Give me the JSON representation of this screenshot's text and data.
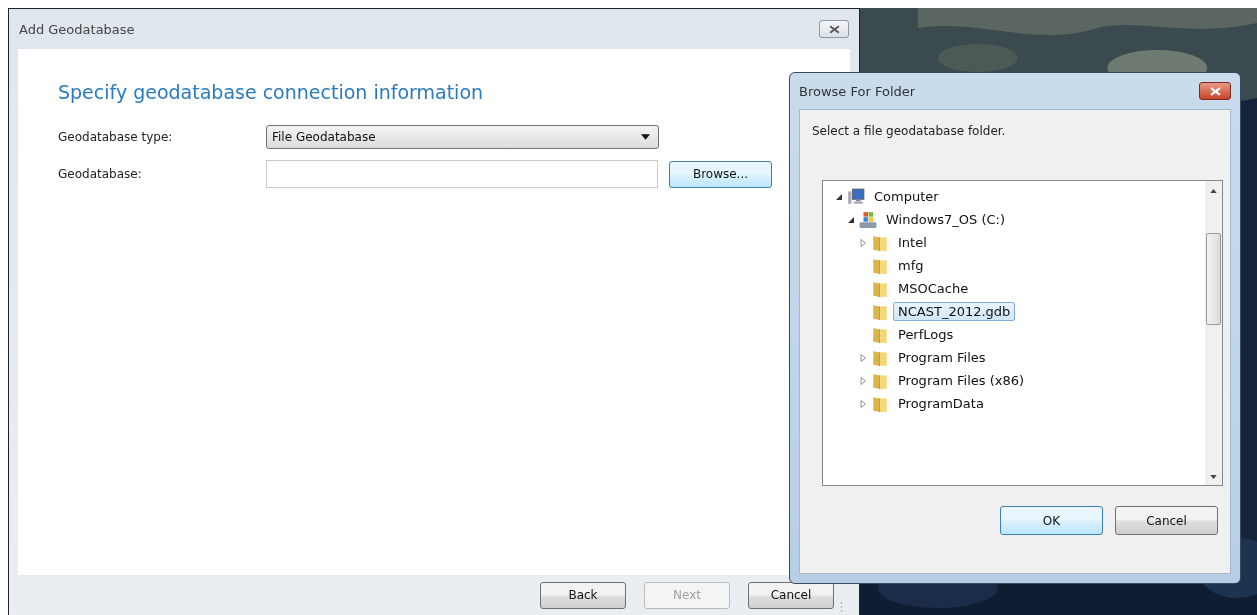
{
  "main_dialog": {
    "title": "Add Geodatabase",
    "heading": "Specify geodatabase connection information",
    "fields": [
      {
        "kind": "dropdown",
        "label": "Geodatabase type:",
        "value": "File Geodatabase"
      },
      {
        "kind": "text",
        "label": "Geodatabase:",
        "button": "Browse..."
      }
    ],
    "buttons": [
      {
        "label": "Back",
        "disabled": false
      },
      {
        "label": "Next",
        "disabled": true
      },
      {
        "label": "Cancel",
        "disabled": false
      }
    ]
  },
  "browse_dialog": {
    "title": "Browse For Folder",
    "prompt": "Select a file geodatabase folder.",
    "tree": [
      {
        "label": "Computer",
        "kind": "computer",
        "expanded": true,
        "selected": false,
        "children": [
          {
            "label": "Windows7_OS (C:)",
            "kind": "drive",
            "expanded": true,
            "selected": false,
            "children": [
              {
                "label": "Intel",
                "kind": "folder",
                "expanded": false,
                "selected": false
              },
              {
                "label": "mfg",
                "kind": "folder",
                "selected": false
              },
              {
                "label": "MSOCache",
                "kind": "folder",
                "selected": false
              },
              {
                "label": "NCAST_2012.gdb",
                "kind": "folder",
                "selected": true
              },
              {
                "label": "PerfLogs",
                "kind": "folder",
                "selected": false
              },
              {
                "label": "Program Files",
                "kind": "folder",
                "expanded": false,
                "selected": false
              },
              {
                "label": "Program Files (x86)",
                "kind": "folder",
                "expanded": false,
                "selected": false
              },
              {
                "label": "ProgramData",
                "kind": "folder",
                "expanded": false,
                "selected": false
              }
            ]
          }
        ]
      }
    ],
    "buttons": [
      {
        "label": "OK",
        "default": true
      },
      {
        "label": "Cancel",
        "default": false
      }
    ]
  }
}
